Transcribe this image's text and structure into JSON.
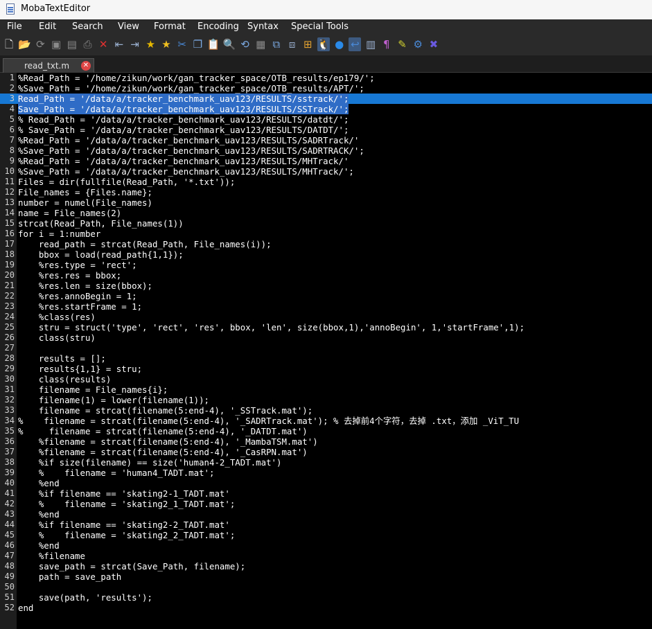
{
  "window": {
    "title": "MobaTextEditor"
  },
  "menu": [
    "File",
    "Edit",
    "Search",
    "View",
    "Format",
    "Encoding",
    "Syntax",
    "Special Tools"
  ],
  "toolbar": [
    {
      "name": "new-file-icon",
      "glyph": "🗋",
      "color": "#e8e8e8"
    },
    {
      "name": "open-folder-icon",
      "glyph": "📂",
      "color": "#e8b84a"
    },
    {
      "name": "reload-icon",
      "glyph": "⟳",
      "color": "#8a8a8a"
    },
    {
      "name": "save-icon",
      "glyph": "▣",
      "color": "#8a8a8a"
    },
    {
      "name": "save-all-icon",
      "glyph": "▤",
      "color": "#8a8a8a"
    },
    {
      "name": "print-icon",
      "glyph": "⎙",
      "color": "#8a8a8a"
    },
    {
      "name": "close-file-icon",
      "glyph": "✕",
      "color": "#e03030"
    },
    {
      "name": "unindent-icon",
      "glyph": "⇤",
      "color": "#9ab0d0"
    },
    {
      "name": "indent-icon",
      "glyph": "⇥",
      "color": "#9ab0d0"
    },
    {
      "name": "bookmark-add-icon",
      "glyph": "★",
      "color": "#e6b800"
    },
    {
      "name": "bookmark-icon",
      "glyph": "★",
      "color": "#f0c020"
    },
    {
      "name": "cut-icon",
      "glyph": "✂",
      "color": "#4a8ad8"
    },
    {
      "name": "copy-icon",
      "glyph": "❐",
      "color": "#7aa8e0"
    },
    {
      "name": "paste-icon",
      "glyph": "📋",
      "color": "#d0d0d0"
    },
    {
      "name": "find-icon",
      "glyph": "🔍",
      "color": "#7aa8e0"
    },
    {
      "name": "find-replace-icon",
      "glyph": "⟲",
      "color": "#7aa8e0"
    },
    {
      "name": "gray-doc-icon",
      "glyph": "▦",
      "color": "#8a8a8a"
    },
    {
      "name": "compare-icon",
      "glyph": "⧉",
      "color": "#7aa8e0"
    },
    {
      "name": "windows-mode-icon",
      "glyph": "⧈",
      "color": "#9ab0d0"
    },
    {
      "name": "windows-eol-icon",
      "glyph": "⊞",
      "color": "#e0a030"
    },
    {
      "name": "linux-eol-icon",
      "glyph": "🐧",
      "color": "#e0e0e0",
      "active": true
    },
    {
      "name": "mac-eol-icon",
      "glyph": "●",
      "color": "#2a8ae8"
    },
    {
      "name": "word-wrap-icon",
      "glyph": "↩",
      "color": "#4a8ad8",
      "active": true
    },
    {
      "name": "split-view-icon",
      "glyph": "▥",
      "color": "#9ab0d0"
    },
    {
      "name": "show-symbols-icon",
      "glyph": "¶",
      "color": "#c060d0"
    },
    {
      "name": "highlight-icon",
      "glyph": "✎",
      "color": "#d0d030"
    },
    {
      "name": "settings-icon",
      "glyph": "⚙",
      "color": "#4a8ad8"
    },
    {
      "name": "close-editor-icon",
      "glyph": "✖",
      "color": "#6a5ae0"
    }
  ],
  "tab": {
    "label": "read_txt.m",
    "close": "✕"
  },
  "lines": [
    "%Read_Path = '/home/zikun/work/gan_tracker_space/OTB_results/ep179/';",
    "%Save_Path = '/home/zikun/work/gan_tracker_space/OTB_results/APT/';",
    "Read_Path = '/data/a/tracker_benchmark_uav123/RESULTS/sstrack/';",
    "Save_Path = '/data/a/tracker_benchmark_uav123/RESULTS/SSTrack/';",
    "% Read_Path = '/data/a/tracker_benchmark_uav123/RESULTS/datdt/';",
    "% Save_Path = '/data/a/tracker_benchmark_uav123/RESULTS/DATDT/';",
    "%Read_Path = '/data/a/tracker_benchmark_uav123/RESULTS/SADRTrack/'",
    "%Save_Path = '/data/a/tracker_benchmark_uav123/RESULTS/SADRTRACK/';",
    "%Read_Path = '/data/a/tracker_benchmark_uav123/RESULTS/MHTrack/'",
    "%Save_Path = '/data/a/tracker_benchmark_uav123/RESULTS/MHTrack/';",
    "Files = dir(fullfile(Read_Path, '*.txt'));",
    "File_names = {Files.name};",
    "number = numel(File_names)",
    "name = File_names(2)",
    "strcat(Read_Path, File_names(1))",
    "for i = 1:number",
    "    read_path = strcat(Read_Path, File_names(i));",
    "    bbox = load(read_path{1,1});",
    "    %res.type = 'rect';",
    "    %res.res = bbox;",
    "    %res.len = size(bbox);",
    "    %res.annoBegin = 1;",
    "    %res.startFrame = 1;",
    "    %class(res)",
    "    stru = struct('type', 'rect', 'res', bbox, 'len', size(bbox,1),'annoBegin', 1,'startFrame',1);",
    "    class(stru)",
    "",
    "    results = [];",
    "    results{1,1} = stru;",
    "    class(results)",
    "    filename = File_names{i};",
    "    filename(1) = lower(filename(1));",
    "    filename = strcat(filename(5:end-4), '_SSTrack.mat');",
    "%    filename = strcat(filename(5:end-4), '_SADRTrack.mat'); % 去掉前4个字符，去掉 .txt，添加 _ViT_TU",
    "%     filename = strcat(filename(5:end-4), '_DATDT.mat')",
    "    %filename = strcat(filename(5:end-4), '_MambaTSM.mat')",
    "    %filename = strcat(filename(5:end-4), '_CasRPN.mat')",
    "    %if size(filename) == size('human4-2_TADT.mat')",
    "    %    filename = 'human4_TADT.mat';",
    "    %end",
    "    %if filename == 'skating2-1_TADT.mat'",
    "    %    filename = 'skating2_1_TADT.mat';",
    "    %end",
    "    %if filename == 'skating2-2_TADT.mat'",
    "    %    filename = 'skating2_2_TADT.mat';",
    "    %end",
    "    %filename",
    "    save_path = strcat(Save_Path, filename);",
    "    path = save_path",
    "",
    "    save(path, 'results');",
    "end"
  ],
  "selected_lines": [
    3,
    4
  ],
  "current_line": 3
}
